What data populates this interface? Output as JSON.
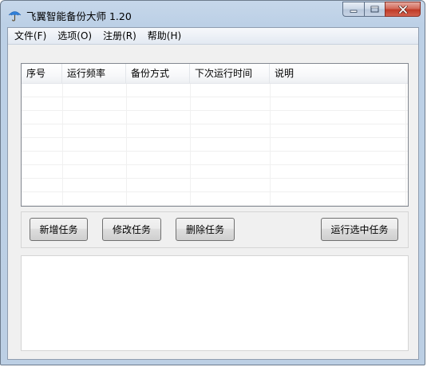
{
  "window": {
    "title": "飞翼智能备份大师 1.20",
    "icon": "umbrella-icon",
    "caption_buttons": [
      "minimize-icon",
      "maximize-icon",
      "close-icon"
    ]
  },
  "menu": {
    "items": [
      {
        "label": "文件(F)"
      },
      {
        "label": "选项(O)"
      },
      {
        "label": "注册(R)"
      },
      {
        "label": "帮助(H)"
      }
    ]
  },
  "task_list": {
    "columns": [
      "序号",
      "运行频率",
      "备份方式",
      "下次运行时间",
      "说明"
    ],
    "rows": []
  },
  "buttons": {
    "add_task": "新增任务",
    "edit_task": "修改任务",
    "delete_task": "删除任务",
    "run_selected": "运行选中任务"
  },
  "log": {
    "text": ""
  },
  "colors": {
    "frame": "#bccfe4",
    "client": "#f0f0f0",
    "close_button": "#c8412d"
  }
}
